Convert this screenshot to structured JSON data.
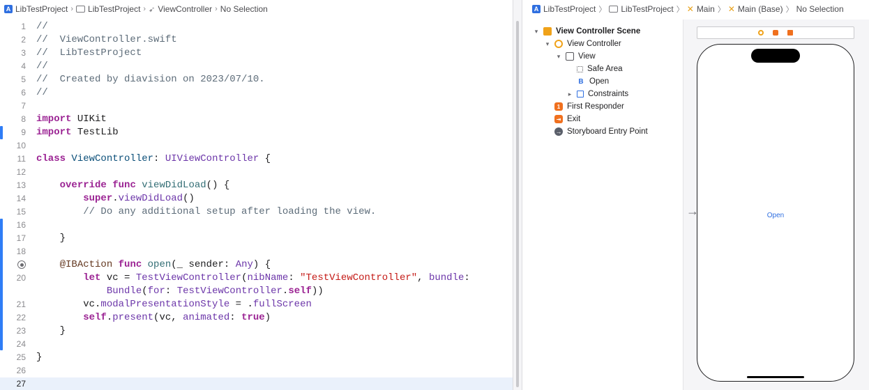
{
  "editor": {
    "breadcrumb": [
      "LibTestProject",
      "LibTestProject",
      "ViewController",
      "No Selection"
    ],
    "lines": [
      {
        "n": "1",
        "html": "<span class='c'>//</span>"
      },
      {
        "n": "2",
        "html": "<span class='c'>//  ViewController.swift</span>"
      },
      {
        "n": "3",
        "html": "<span class='c'>//  LibTestProject</span>"
      },
      {
        "n": "4",
        "html": "<span class='c'>//</span>"
      },
      {
        "n": "5",
        "html": "<span class='c'>//  Created by diavision on 2023/07/10.</span>"
      },
      {
        "n": "6",
        "html": "<span class='c'>//</span>"
      },
      {
        "n": "7",
        "html": ""
      },
      {
        "n": "8",
        "html": "<span class='k'>import</span> UIKit"
      },
      {
        "n": "9",
        "html": "<span class='k'>import</span> TestLib"
      },
      {
        "n": "10",
        "html": ""
      },
      {
        "n": "11",
        "html": "<span class='k'>class</span> <span class='t'>ViewController</span>: <span class='p'>UIViewController</span> {"
      },
      {
        "n": "12",
        "html": ""
      },
      {
        "n": "13",
        "html": "    <span class='k'>override</span> <span class='k'>func</span> <span class='f'>viewDidLoad</span>() {"
      },
      {
        "n": "14",
        "html": "        <span class='k'>super</span>.<span class='p'>viewDidLoad</span>()"
      },
      {
        "n": "15",
        "html": "        <span class='c'>// Do any additional setup after loading the view.</span>"
      },
      {
        "n": "16",
        "html": ""
      },
      {
        "n": "17",
        "html": "    }"
      },
      {
        "n": "18",
        "html": ""
      },
      {
        "n": "",
        "html": "    <span class='a'>@IBAction</span> <span class='k'>func</span> <span class='f'>open</span>(_ sender: <span class='p'>Any</span>) {",
        "breakpoint": true
      },
      {
        "n": "20",
        "html": "        <span class='k'>let</span> vc = <span class='p'>TestViewController</span>(<span class='p'>nibName</span>: <span class='s'>\"TestViewController\"</span>, <span class='p'>bundle</span>:"
      },
      {
        "n": "",
        "html": "            <span class='p'>Bundle</span>(<span class='p'>for</span>: <span class='p'>TestViewController</span>.<span class='k'>self</span>))",
        "cont": true
      },
      {
        "n": "21",
        "html": "        vc.<span class='p'>modalPresentationStyle</span> = .<span class='p'>fullScreen</span>"
      },
      {
        "n": "22",
        "html": "        <span class='k'>self</span>.<span class='p'>present</span>(vc, <span class='p'>animated</span>: <span class='k'>true</span>)"
      },
      {
        "n": "23",
        "html": "    }"
      },
      {
        "n": "24",
        "html": ""
      },
      {
        "n": "25",
        "html": "}"
      },
      {
        "n": "26",
        "html": ""
      },
      {
        "n": "27",
        "html": "",
        "current": true
      }
    ]
  },
  "ib": {
    "breadcrumb": [
      "LibTestProject",
      "LibTestProject",
      "Main",
      "Main (Base)",
      "No Selection"
    ],
    "outline": [
      {
        "label": "View Controller Scene",
        "icon": "scene",
        "depth": 0,
        "disclosure": "open",
        "bold": true
      },
      {
        "label": "View Controller",
        "icon": "vc",
        "depth": 1,
        "disclosure": "open"
      },
      {
        "label": "View",
        "icon": "view",
        "depth": 2,
        "disclosure": "open"
      },
      {
        "label": "Safe Area",
        "icon": "safe",
        "depth": 3,
        "disclosure": ""
      },
      {
        "label": "Open",
        "icon": "btn",
        "depth": 3,
        "disclosure": ""
      },
      {
        "label": "Constraints",
        "icon": "cons",
        "depth": 3,
        "disclosure": "closed"
      },
      {
        "label": "First Responder",
        "icon": "resp",
        "depth": 1,
        "disclosure": ""
      },
      {
        "label": "Exit",
        "icon": "exit",
        "depth": 1,
        "disclosure": ""
      },
      {
        "label": "Storyboard Entry Point",
        "icon": "entry",
        "depth": 1,
        "disclosure": ""
      }
    ],
    "canvas": {
      "button_label": "Open"
    }
  },
  "colors": {
    "accent": "#2f6fe0",
    "change_bar": "#2f7df6",
    "storyboard_orange": "#f0a219"
  },
  "icons": {
    "project": "xcode-project-icon",
    "folder": "folder-icon",
    "swift": "swift-file-icon",
    "storyboard": "storyboard-icon"
  }
}
